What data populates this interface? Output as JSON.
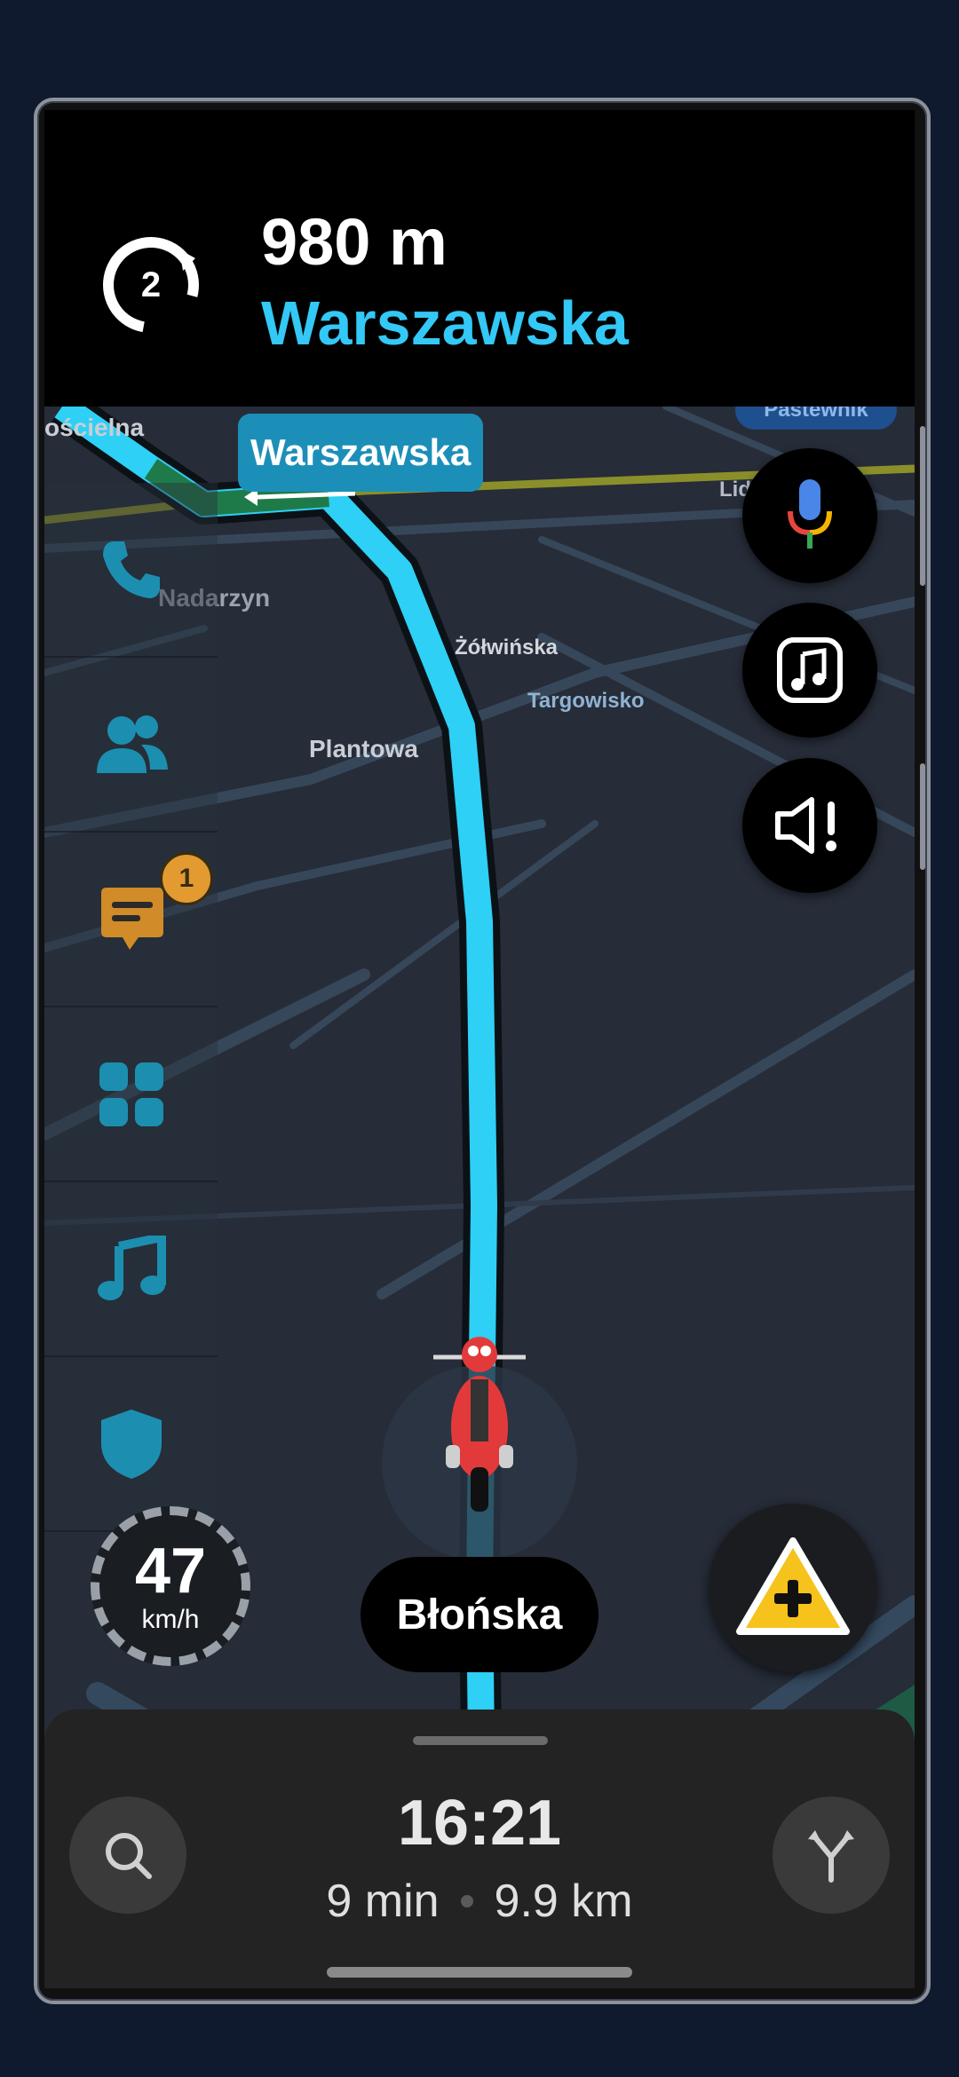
{
  "navigation": {
    "exit_number": "2",
    "distance": "980 m",
    "street": "Warszawska"
  },
  "map": {
    "callout_street": "Warszawska",
    "labels": {
      "koscielna": "ościelna",
      "nadarzyn": "Nadarzyn",
      "zolwinska": "Żółwińska",
      "targowisko": "Targowisko",
      "plantowa": "Plantowa",
      "pastewnik": "Pastewnik",
      "lidl": "Lidl"
    }
  },
  "dock": {
    "items": [
      {
        "name": "phone",
        "icon": "phone-icon"
      },
      {
        "name": "contacts",
        "icon": "people-icon"
      },
      {
        "name": "messages",
        "icon": "message-icon",
        "badge": "1"
      },
      {
        "name": "apps",
        "icon": "grid-icon"
      },
      {
        "name": "music",
        "icon": "music-note-icon"
      },
      {
        "name": "safety",
        "icon": "shield-icon"
      }
    ]
  },
  "speed": {
    "value": "47",
    "unit": "km/h"
  },
  "current_street": "Błońska",
  "trip": {
    "eta": "16:21",
    "duration": "9 min",
    "distance": "9.9 km"
  },
  "colors": {
    "route": "#2ed0f5",
    "accent_text": "#33c8f5",
    "report": "#f6c21c",
    "badge": "#e29a31"
  }
}
